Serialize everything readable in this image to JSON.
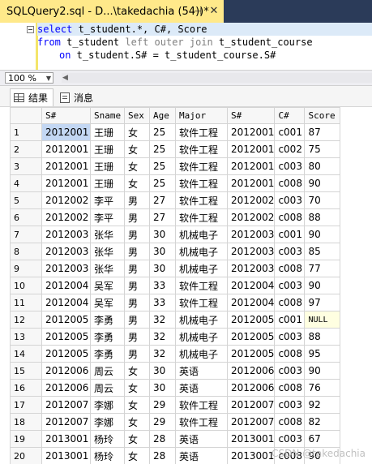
{
  "document_tab": {
    "title": "SQLQuery2.sql - D...\\takedachia (54))*",
    "pin_icon": "pin-icon",
    "close_icon": "close-icon"
  },
  "editor": {
    "line1": {
      "kw": "select",
      "rest": " t_student.*, C#, Score"
    },
    "line2": {
      "kw1": "from",
      "t1": " t_student ",
      "join": "left outer join",
      "t2": " t_student_course"
    },
    "line3": {
      "kw": "on",
      "rest": " t_student.S# = t_student_course.S#"
    }
  },
  "zoom": {
    "value": "100 %"
  },
  "result_tabs": {
    "results_label": "结果",
    "messages_label": "消息"
  },
  "grid": {
    "columns": [
      "",
      "S#",
      "Sname",
      "Sex",
      "Age",
      "Major",
      "S#",
      "C#",
      "Score"
    ],
    "rows": [
      [
        "1",
        "2012001",
        "王珊",
        "女",
        "25",
        "软件工程",
        "2012001",
        "c001",
        "87"
      ],
      [
        "2",
        "2012001",
        "王珊",
        "女",
        "25",
        "软件工程",
        "2012001",
        "c002",
        "75"
      ],
      [
        "3",
        "2012001",
        "王珊",
        "女",
        "25",
        "软件工程",
        "2012001",
        "c003",
        "80"
      ],
      [
        "4",
        "2012001",
        "王珊",
        "女",
        "25",
        "软件工程",
        "2012001",
        "c008",
        "90"
      ],
      [
        "5",
        "2012002",
        "李平",
        "男",
        "27",
        "软件工程",
        "2012002",
        "c003",
        "70"
      ],
      [
        "6",
        "2012002",
        "李平",
        "男",
        "27",
        "软件工程",
        "2012002",
        "c008",
        "88"
      ],
      [
        "7",
        "2012003",
        "张华",
        "男",
        "30",
        "机械电子",
        "2012003",
        "c001",
        "90"
      ],
      [
        "8",
        "2012003",
        "张华",
        "男",
        "30",
        "机械电子",
        "2012003",
        "c003",
        "85"
      ],
      [
        "9",
        "2012003",
        "张华",
        "男",
        "30",
        "机械电子",
        "2012003",
        "c008",
        "77"
      ],
      [
        "10",
        "2012004",
        "吴军",
        "男",
        "33",
        "软件工程",
        "2012004",
        "c003",
        "90"
      ],
      [
        "11",
        "2012004",
        "吴军",
        "男",
        "33",
        "软件工程",
        "2012004",
        "c008",
        "97"
      ],
      [
        "12",
        "2012005",
        "李勇",
        "男",
        "32",
        "机械电子",
        "2012005",
        "c001",
        "NULL"
      ],
      [
        "13",
        "2012005",
        "李勇",
        "男",
        "32",
        "机械电子",
        "2012005",
        "c003",
        "88"
      ],
      [
        "14",
        "2012005",
        "李勇",
        "男",
        "32",
        "机械电子",
        "2012005",
        "c008",
        "95"
      ],
      [
        "15",
        "2012006",
        "周云",
        "女",
        "30",
        "英语",
        "2012006",
        "c003",
        "90"
      ],
      [
        "16",
        "2012006",
        "周云",
        "女",
        "30",
        "英语",
        "2012006",
        "c008",
        "76"
      ],
      [
        "17",
        "2012007",
        "李娜",
        "女",
        "29",
        "软件工程",
        "2012007",
        "c003",
        "92"
      ],
      [
        "18",
        "2012007",
        "李娜",
        "女",
        "29",
        "软件工程",
        "2012007",
        "c008",
        "82"
      ],
      [
        "19",
        "2013001",
        "杨玲",
        "女",
        "28",
        "英语",
        "2013001",
        "c003",
        "67"
      ],
      [
        "20",
        "2013001",
        "杨玲",
        "女",
        "28",
        "英语",
        "2013001",
        "c008",
        "90"
      ]
    ]
  },
  "watermark": "CSDN @takedachia",
  "colors": {
    "tab_active": "#ffe98a",
    "keyword": "#0000ff",
    "selected_cell": "#c3d7f3",
    "null_cell": "#ffffe1"
  }
}
